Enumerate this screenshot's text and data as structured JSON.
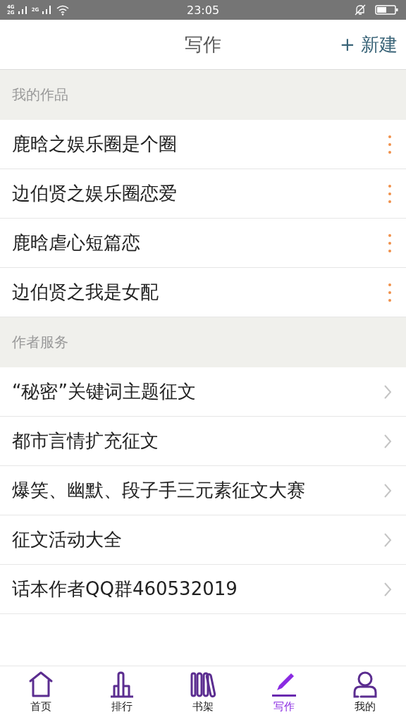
{
  "status_bar": {
    "sim_labels": [
      "4G",
      "2G",
      "2G"
    ],
    "time": "23:05"
  },
  "header": {
    "title": "写作",
    "action": "+ 新建"
  },
  "sections": [
    {
      "title": "我的作品",
      "kind": "works",
      "items": [
        {
          "label": "鹿晗之娱乐圈是个圈"
        },
        {
          "label": "边伯贤之娱乐圈恋爱"
        },
        {
          "label": "鹿晗虐心短篇恋"
        },
        {
          "label": "边伯贤之我是女配"
        }
      ]
    },
    {
      "title": "作者服务",
      "kind": "services",
      "items": [
        {
          "label": "“秘密”关键词主题征文"
        },
        {
          "label": "都市言情扩充征文"
        },
        {
          "label": "爆笑、幽默、段子手三元素征文大赛"
        },
        {
          "label": "征文活动大全"
        },
        {
          "label": "话本作者QQ群460532019"
        }
      ]
    }
  ],
  "tab_bar": [
    {
      "label": "首页",
      "kind": "home",
      "selected": false
    },
    {
      "label": "排行",
      "kind": "rank",
      "selected": false
    },
    {
      "label": "书架",
      "kind": "shelf",
      "selected": false
    },
    {
      "label": "写作",
      "kind": "write",
      "selected": true
    },
    {
      "label": "我的",
      "kind": "user",
      "selected": false
    }
  ]
}
